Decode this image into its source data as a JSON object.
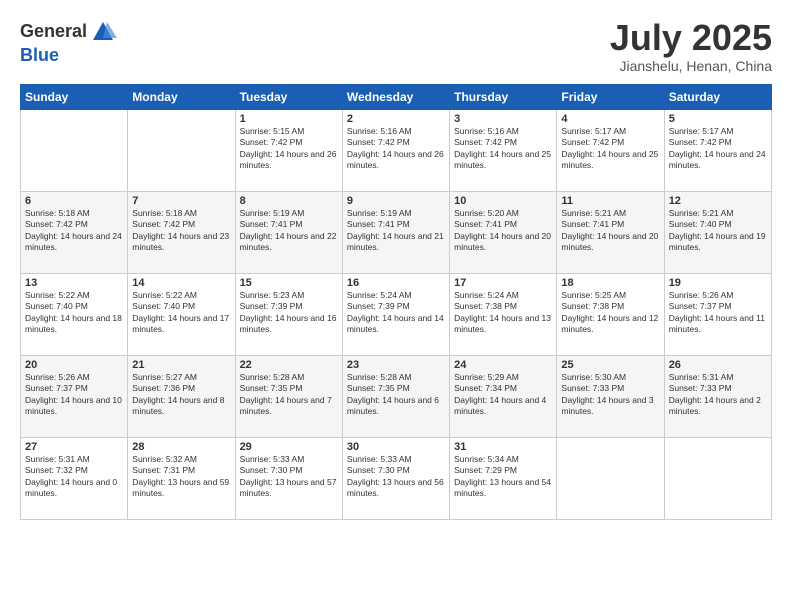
{
  "header": {
    "logo_line1": "General",
    "logo_line2": "Blue",
    "month": "July 2025",
    "location": "Jianshelu, Henan, China"
  },
  "days_of_week": [
    "Sunday",
    "Monday",
    "Tuesday",
    "Wednesday",
    "Thursday",
    "Friday",
    "Saturday"
  ],
  "weeks": [
    [
      {
        "day": "",
        "info": ""
      },
      {
        "day": "",
        "info": ""
      },
      {
        "day": "1",
        "info": "Sunrise: 5:15 AM\nSunset: 7:42 PM\nDaylight: 14 hours and 26 minutes."
      },
      {
        "day": "2",
        "info": "Sunrise: 5:16 AM\nSunset: 7:42 PM\nDaylight: 14 hours and 26 minutes."
      },
      {
        "day": "3",
        "info": "Sunrise: 5:16 AM\nSunset: 7:42 PM\nDaylight: 14 hours and 25 minutes."
      },
      {
        "day": "4",
        "info": "Sunrise: 5:17 AM\nSunset: 7:42 PM\nDaylight: 14 hours and 25 minutes."
      },
      {
        "day": "5",
        "info": "Sunrise: 5:17 AM\nSunset: 7:42 PM\nDaylight: 14 hours and 24 minutes."
      }
    ],
    [
      {
        "day": "6",
        "info": "Sunrise: 5:18 AM\nSunset: 7:42 PM\nDaylight: 14 hours and 24 minutes."
      },
      {
        "day": "7",
        "info": "Sunrise: 5:18 AM\nSunset: 7:42 PM\nDaylight: 14 hours and 23 minutes."
      },
      {
        "day": "8",
        "info": "Sunrise: 5:19 AM\nSunset: 7:41 PM\nDaylight: 14 hours and 22 minutes."
      },
      {
        "day": "9",
        "info": "Sunrise: 5:19 AM\nSunset: 7:41 PM\nDaylight: 14 hours and 21 minutes."
      },
      {
        "day": "10",
        "info": "Sunrise: 5:20 AM\nSunset: 7:41 PM\nDaylight: 14 hours and 20 minutes."
      },
      {
        "day": "11",
        "info": "Sunrise: 5:21 AM\nSunset: 7:41 PM\nDaylight: 14 hours and 20 minutes."
      },
      {
        "day": "12",
        "info": "Sunrise: 5:21 AM\nSunset: 7:40 PM\nDaylight: 14 hours and 19 minutes."
      }
    ],
    [
      {
        "day": "13",
        "info": "Sunrise: 5:22 AM\nSunset: 7:40 PM\nDaylight: 14 hours and 18 minutes."
      },
      {
        "day": "14",
        "info": "Sunrise: 5:22 AM\nSunset: 7:40 PM\nDaylight: 14 hours and 17 minutes."
      },
      {
        "day": "15",
        "info": "Sunrise: 5:23 AM\nSunset: 7:39 PM\nDaylight: 14 hours and 16 minutes."
      },
      {
        "day": "16",
        "info": "Sunrise: 5:24 AM\nSunset: 7:39 PM\nDaylight: 14 hours and 14 minutes."
      },
      {
        "day": "17",
        "info": "Sunrise: 5:24 AM\nSunset: 7:38 PM\nDaylight: 14 hours and 13 minutes."
      },
      {
        "day": "18",
        "info": "Sunrise: 5:25 AM\nSunset: 7:38 PM\nDaylight: 14 hours and 12 minutes."
      },
      {
        "day": "19",
        "info": "Sunrise: 5:26 AM\nSunset: 7:37 PM\nDaylight: 14 hours and 11 minutes."
      }
    ],
    [
      {
        "day": "20",
        "info": "Sunrise: 5:26 AM\nSunset: 7:37 PM\nDaylight: 14 hours and 10 minutes."
      },
      {
        "day": "21",
        "info": "Sunrise: 5:27 AM\nSunset: 7:36 PM\nDaylight: 14 hours and 8 minutes."
      },
      {
        "day": "22",
        "info": "Sunrise: 5:28 AM\nSunset: 7:35 PM\nDaylight: 14 hours and 7 minutes."
      },
      {
        "day": "23",
        "info": "Sunrise: 5:28 AM\nSunset: 7:35 PM\nDaylight: 14 hours and 6 minutes."
      },
      {
        "day": "24",
        "info": "Sunrise: 5:29 AM\nSunset: 7:34 PM\nDaylight: 14 hours and 4 minutes."
      },
      {
        "day": "25",
        "info": "Sunrise: 5:30 AM\nSunset: 7:33 PM\nDaylight: 14 hours and 3 minutes."
      },
      {
        "day": "26",
        "info": "Sunrise: 5:31 AM\nSunset: 7:33 PM\nDaylight: 14 hours and 2 minutes."
      }
    ],
    [
      {
        "day": "27",
        "info": "Sunrise: 5:31 AM\nSunset: 7:32 PM\nDaylight: 14 hours and 0 minutes."
      },
      {
        "day": "28",
        "info": "Sunrise: 5:32 AM\nSunset: 7:31 PM\nDaylight: 13 hours and 59 minutes."
      },
      {
        "day": "29",
        "info": "Sunrise: 5:33 AM\nSunset: 7:30 PM\nDaylight: 13 hours and 57 minutes."
      },
      {
        "day": "30",
        "info": "Sunrise: 5:33 AM\nSunset: 7:30 PM\nDaylight: 13 hours and 56 minutes."
      },
      {
        "day": "31",
        "info": "Sunrise: 5:34 AM\nSunset: 7:29 PM\nDaylight: 13 hours and 54 minutes."
      },
      {
        "day": "",
        "info": ""
      },
      {
        "day": "",
        "info": ""
      }
    ]
  ]
}
